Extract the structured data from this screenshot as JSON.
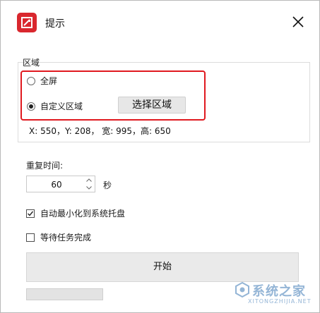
{
  "window": {
    "title": "提示",
    "app_icon": "app-logo-icon",
    "close_icon": "close-icon"
  },
  "region": {
    "label": "区域",
    "options": [
      {
        "label": "全屏",
        "selected": false
      },
      {
        "label": "自定义区域",
        "selected": true
      }
    ],
    "select_button": "选择区域",
    "coords_text": "X: 550，Y: 208， 宽: 995，高: 650"
  },
  "repeat": {
    "label": "重复时间:",
    "value": "60",
    "unit": "秒"
  },
  "options": {
    "minimize": {
      "label": "自动最小化到系统托盘",
      "checked": true
    },
    "wait": {
      "label": "等待任务完成",
      "checked": false
    }
  },
  "start_button": "开始",
  "progress": {
    "value": 0
  },
  "watermark": {
    "text": "系统之家",
    "sub": "XITONGZHIJIA.NET"
  },
  "colors": {
    "accent_red": "#e0191f",
    "app_icon_red": "#d9272e"
  }
}
